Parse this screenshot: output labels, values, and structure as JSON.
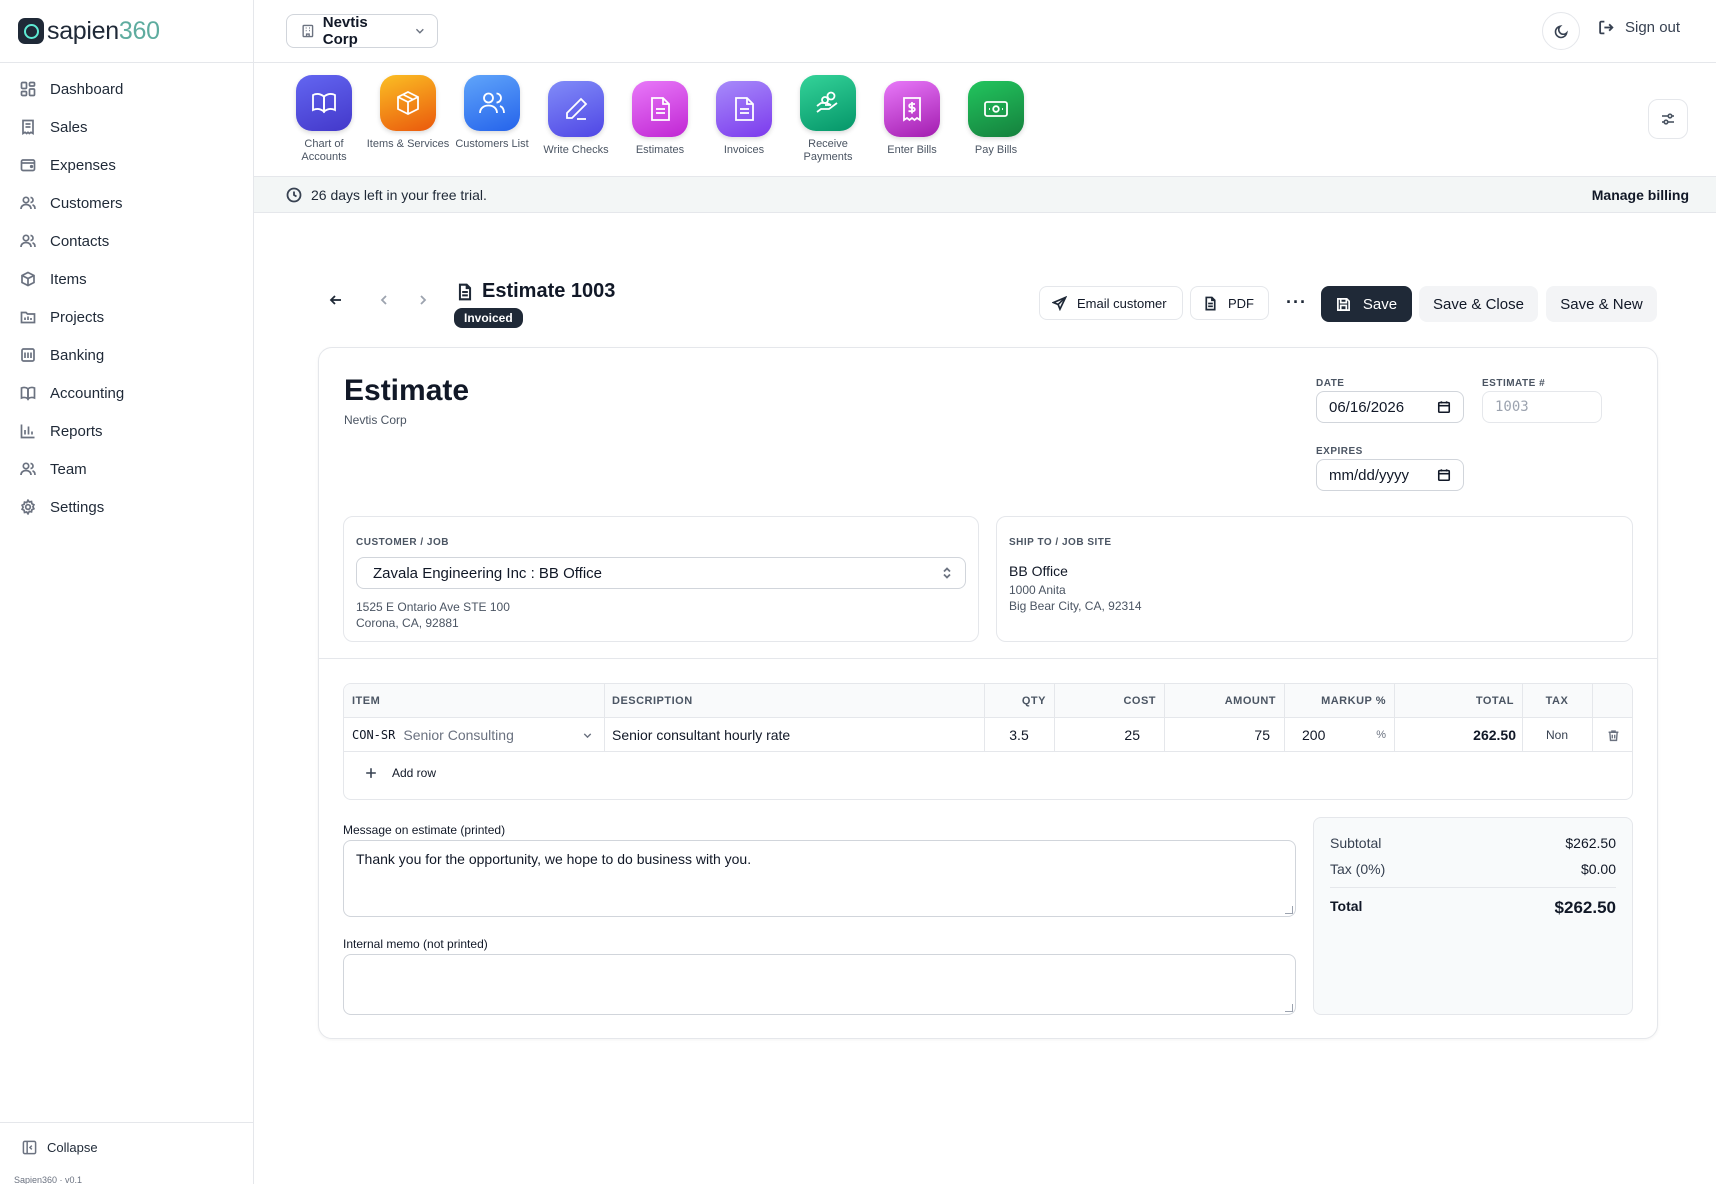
{
  "brand": {
    "name_prefix": "sapien",
    "name_suffix": "360",
    "version": "Sapien360 · v0.1"
  },
  "sidebar": {
    "items": [
      {
        "label": "Dashboard",
        "icon": "dashboard-icon"
      },
      {
        "label": "Sales",
        "icon": "receipt-icon"
      },
      {
        "label": "Expenses",
        "icon": "wallet-icon"
      },
      {
        "label": "Customers",
        "icon": "users-icon"
      },
      {
        "label": "Contacts",
        "icon": "contacts-icon"
      },
      {
        "label": "Items",
        "icon": "box-icon"
      },
      {
        "label": "Projects",
        "icon": "folder-icon"
      },
      {
        "label": "Banking",
        "icon": "bank-icon"
      },
      {
        "label": "Accounting",
        "icon": "book-icon"
      },
      {
        "label": "Reports",
        "icon": "bar-chart-icon"
      },
      {
        "label": "Team",
        "icon": "team-icon"
      },
      {
        "label": "Settings",
        "icon": "gear-icon"
      }
    ],
    "collapse_label": "Collapse"
  },
  "topbar": {
    "company": "Nevtis Corp",
    "signout": "Sign out"
  },
  "launcher": {
    "apps": [
      {
        "label": "Chart of Accounts",
        "color": "#4f46e5",
        "icon": "book-open-icon"
      },
      {
        "label": "Items & Services",
        "color": "#f59e0b",
        "icon": "package-icon"
      },
      {
        "label": "Customers List",
        "color": "#3b82f6",
        "icon": "users-icon"
      },
      {
        "label": "Write Checks",
        "color": "#6366f1",
        "icon": "pen-icon"
      },
      {
        "label": "Estimates",
        "color": "#d946ef",
        "icon": "file-text-icon"
      },
      {
        "label": "Invoices",
        "color": "#8b5cf6",
        "icon": "file-text-icon"
      },
      {
        "label": "Receive Payments",
        "color": "#10b981",
        "icon": "hand-coins-icon"
      },
      {
        "label": "Enter Bills",
        "color": "#c026d3",
        "icon": "receipt-dollar-icon"
      },
      {
        "label": "Pay Bills",
        "color": "#16a34a",
        "icon": "banknote-icon"
      }
    ]
  },
  "trial": {
    "message": "26 days left in your free trial.",
    "manage": "Manage billing"
  },
  "document": {
    "title": "Estimate 1003",
    "status": "Invoiced",
    "actions": {
      "email": "Email customer",
      "pdf": "PDF",
      "more": "···",
      "save": "Save",
      "save_close": "Save & Close",
      "save_new": "Save & New"
    }
  },
  "estimate": {
    "heading": "Estimate",
    "company": "Nevtis Corp",
    "date_label": "DATE",
    "date_value": "06/16/2026",
    "number_label": "ESTIMATE #",
    "number_placeholder": "1003",
    "expires_label": "EXPIRES",
    "expires_value": "mm/dd/yyyy",
    "customer_label": "CUSTOMER / JOB",
    "customer_value": "Zavala Engineering Inc : BB Office",
    "customer_address_1": "1525 E Ontario Ave STE 100",
    "customer_address_2": "Corona, CA, 92881",
    "ship_label": "SHIP TO / JOB SITE",
    "ship_name": "BB Office",
    "ship_address_1": "1000 Anita",
    "ship_address_2": "Big Bear City, CA, 92314"
  },
  "lines": {
    "headers": [
      "ITEM",
      "DESCRIPTION",
      "QTY",
      "COST",
      "AMOUNT",
      "MARKUP %",
      "TOTAL",
      "TAX"
    ],
    "rows": [
      {
        "code": "CON-SR",
        "name": "Senior Consulting",
        "description": "Senior consultant hourly rate",
        "qty": "3.5",
        "cost": "25",
        "amount": "75",
        "markup": "200",
        "markup_unit": "%",
        "total": "262.50",
        "tax": "Non"
      }
    ],
    "add_row": "Add row"
  },
  "memo": {
    "message_label": "Message on estimate (printed)",
    "message_value": "Thank you for the opportunity, we hope to do business with you.",
    "internal_label": "Internal memo (not printed)",
    "internal_value": ""
  },
  "totals": {
    "subtotal_label": "Subtotal",
    "subtotal": "$262.50",
    "tax_label": "Tax (0%)",
    "tax": "$0.00",
    "total_label": "Total",
    "total": "$262.50"
  }
}
